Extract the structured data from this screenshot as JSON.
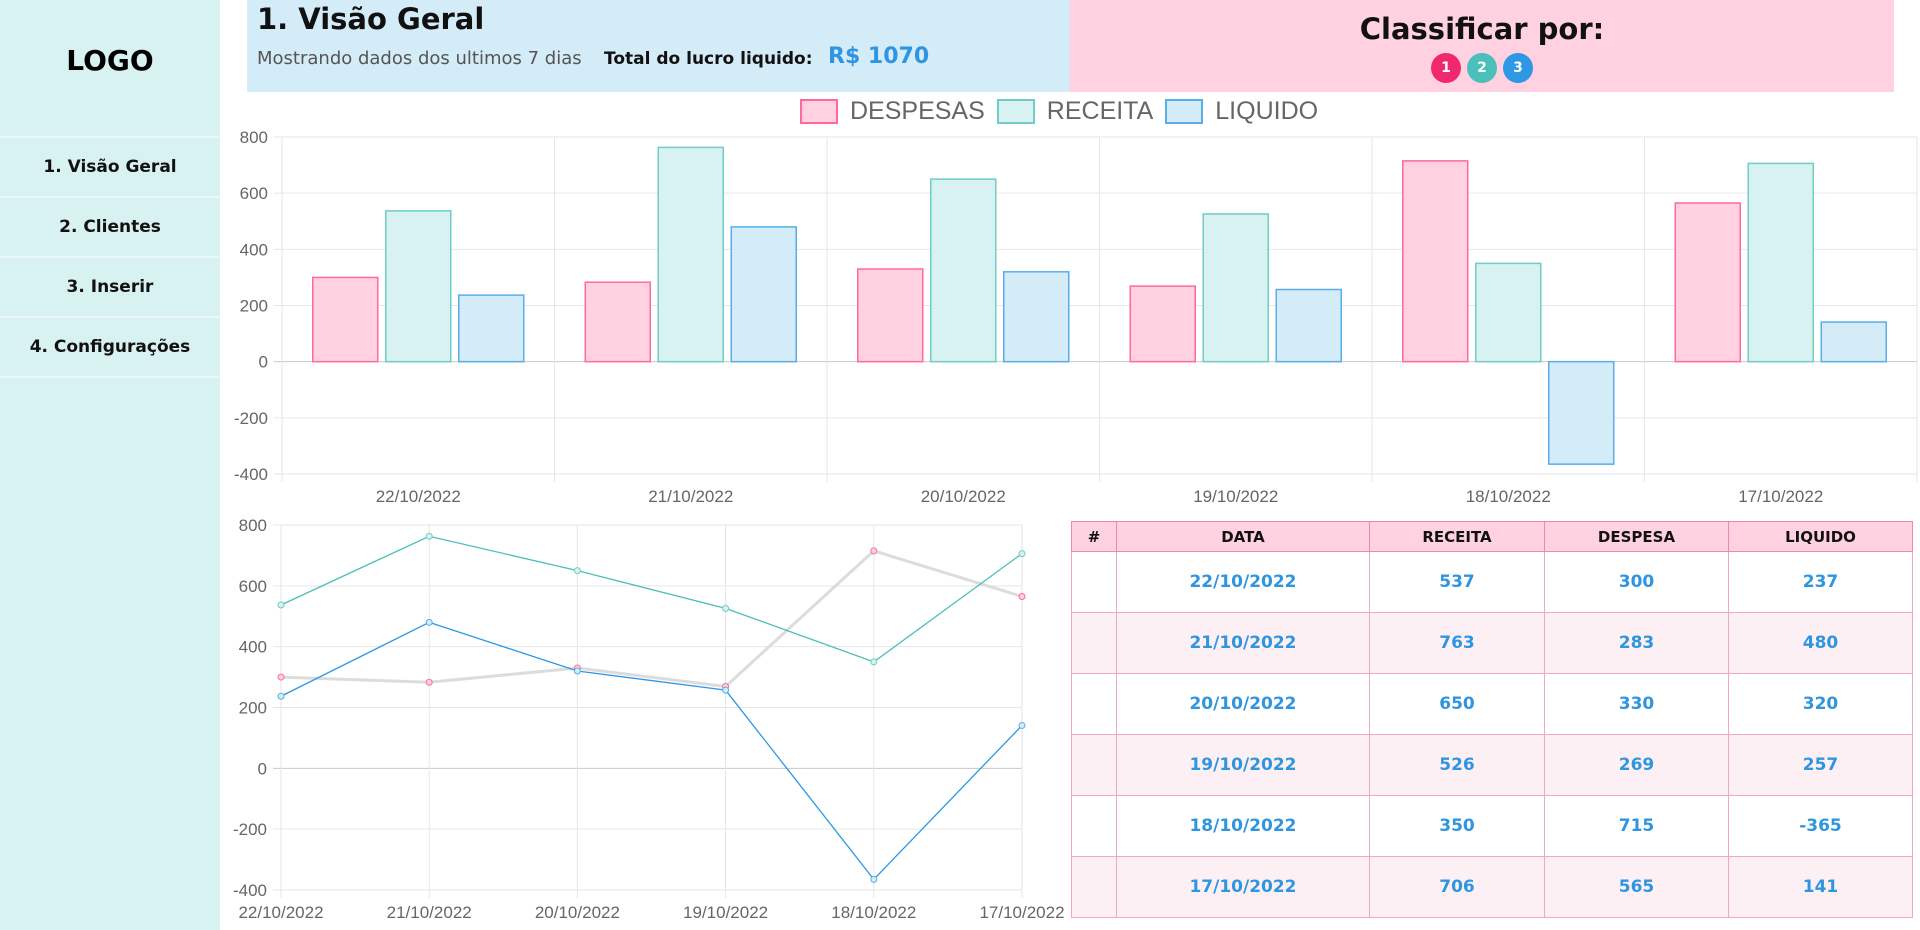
{
  "sidebar": {
    "logo": "LOGO",
    "items": [
      {
        "label": "1. Visão Geral"
      },
      {
        "label": "2. Clientes"
      },
      {
        "label": "3. Inserir"
      },
      {
        "label": "4. Configurações"
      }
    ]
  },
  "header": {
    "title": "1. Visão Geral",
    "subtitle": "Mostrando dados dos ultimos 7 dias",
    "total_label": "Total do lucro liquido:",
    "total_value": "R$ 1070"
  },
  "sort": {
    "title": "Classificar por:",
    "buttons": [
      {
        "label": "1",
        "color": "#f0286e"
      },
      {
        "label": "2",
        "color": "#4bbfb9"
      },
      {
        "label": "3",
        "color": "#2d98e3"
      }
    ]
  },
  "colors": {
    "despesas_fill": "#ffd1e1",
    "despesas_stroke": "#ff6b96",
    "receita_fill": "#d8f1f1",
    "receita_stroke": "#71cbc7",
    "liquido_fill": "#d4ebf8",
    "liquido_stroke": "#59aee8",
    "line_despesas": "#dcdcdc",
    "line_receita": "#4bbfb9",
    "line_liquido": "#2d98e3",
    "accent": "#2f95e0"
  },
  "chart_data": [
    {
      "type": "bar",
      "categories": [
        "22/10/2022",
        "21/10/2022",
        "20/10/2022",
        "19/10/2022",
        "18/10/2022",
        "17/10/2022"
      ],
      "series": [
        {
          "name": "DESPESAS",
          "values": [
            300,
            283,
            330,
            269,
            715,
            565
          ]
        },
        {
          "name": "RECEITA",
          "values": [
            537,
            763,
            650,
            526,
            350,
            706
          ]
        },
        {
          "name": "LIQUIDO",
          "values": [
            237,
            480,
            320,
            257,
            -365,
            141
          ]
        }
      ],
      "yticks": [
        "800",
        "600",
        "400",
        "200",
        "0",
        "-200",
        "-400"
      ],
      "ylim": [
        -400,
        800
      ],
      "legend": "top-center",
      "grid": true
    },
    {
      "type": "line",
      "categories": [
        "22/10/2022",
        "21/10/2022",
        "20/10/2022",
        "19/10/2022",
        "18/10/2022",
        "17/10/2022"
      ],
      "series": [
        {
          "values": [
            300,
            283,
            330,
            269,
            715,
            565
          ]
        },
        {
          "values": [
            537,
            763,
            650,
            526,
            350,
            706
          ]
        },
        {
          "values": [
            237,
            480,
            320,
            257,
            -365,
            141
          ]
        }
      ],
      "yticks": [
        "800",
        "600",
        "400",
        "200",
        "0",
        "-200",
        "-400"
      ],
      "ylim": [
        -400,
        800
      ],
      "grid": true
    }
  ],
  "table": {
    "headers": [
      "#",
      "DATA",
      "RECEITA",
      "DESPESA",
      "LIQUIDO"
    ],
    "rows": [
      [
        "",
        "22/10/2022",
        "537",
        "300",
        "237"
      ],
      [
        "",
        "21/10/2022",
        "763",
        "283",
        "480"
      ],
      [
        "",
        "20/10/2022",
        "650",
        "330",
        "320"
      ],
      [
        "",
        "19/10/2022",
        "526",
        "269",
        "257"
      ],
      [
        "",
        "18/10/2022",
        "350",
        "715",
        "-365"
      ],
      [
        "",
        "17/10/2022",
        "706",
        "565",
        "141"
      ]
    ]
  }
}
